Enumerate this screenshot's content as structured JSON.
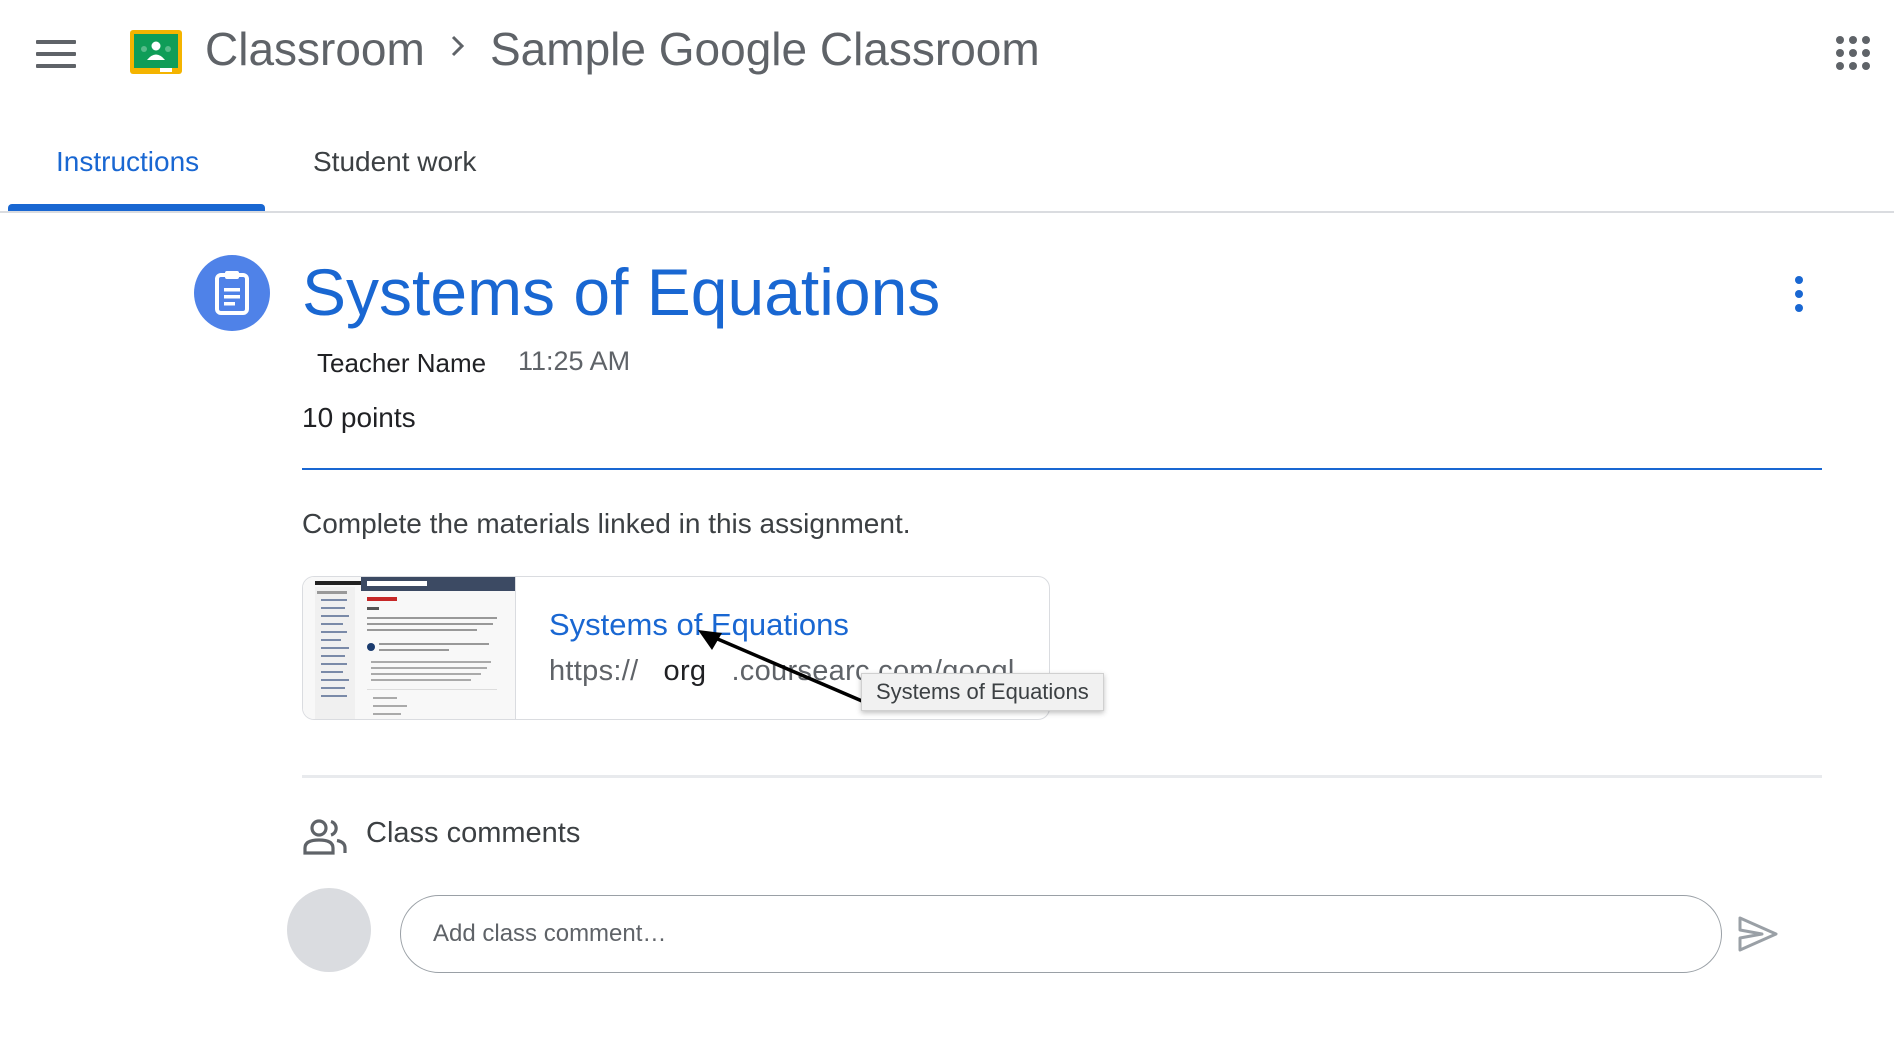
{
  "header": {
    "app_name": "Classroom",
    "breadcrumb_separator_icon": "chevron-right-icon",
    "class_name": "Sample Google Classroom",
    "menu_icon": "hamburger-menu-icon",
    "apps_icon": "google-apps-grid-icon"
  },
  "tabs": [
    {
      "label": "Instructions",
      "active": true
    },
    {
      "label": "Student work",
      "active": false
    }
  ],
  "assignment": {
    "icon": "assignment-clipboard-icon",
    "title": "Systems of Equations",
    "teacher": "Teacher Name",
    "time": "11:25 AM",
    "points": "10 points",
    "instructions": "Complete the materials linked in this assignment.",
    "more_icon": "more-vert-icon"
  },
  "attachment": {
    "title": "Systems of Equations",
    "url_prefix": "https://",
    "url_org": "org",
    "url_rest": ".coursearc.com/googl",
    "tooltip": "Systems of Equations"
  },
  "comments": {
    "label": "Class comments",
    "placeholder": "Add class comment…",
    "send_icon": "send-icon"
  },
  "colors": {
    "accent": "#1967d2",
    "assignment_icon_bg": "#4f82e8",
    "text_primary": "#202124",
    "text_secondary": "#5f6368"
  }
}
